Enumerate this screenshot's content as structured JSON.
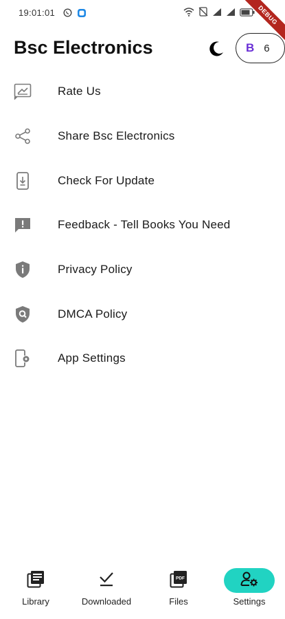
{
  "status_bar": {
    "time": "19:01:01",
    "debug_banner": "DEBUG",
    "icons": [
      "whatsapp-icon",
      "app-icon",
      "wifi-icon",
      "no-sim-icon",
      "signal-icon",
      "signal-icon",
      "battery-icon"
    ]
  },
  "header": {
    "title": "Bsc Electronics",
    "theme_icon": "moon-icon",
    "coin_symbol": "B",
    "coin_count": "6"
  },
  "menu": {
    "items": [
      {
        "label": "Rate Us",
        "icon": "rate-us-icon"
      },
      {
        "label": "Share Bsc Electronics",
        "icon": "share-icon"
      },
      {
        "label": "Check For Update",
        "icon": "phone-download-icon"
      },
      {
        "label": "Feedback - Tell Books You Need",
        "icon": "feedback-icon"
      },
      {
        "label": "Privacy Policy",
        "icon": "shield-info-icon"
      },
      {
        "label": "DMCA Policy",
        "icon": "shield-search-icon"
      },
      {
        "label": "App Settings",
        "icon": "phone-settings-icon"
      }
    ]
  },
  "bottom_nav": {
    "items": [
      {
        "label": "Library",
        "icon": "library-icon",
        "active": false
      },
      {
        "label": "Downloaded",
        "icon": "checkmark-icon",
        "active": false
      },
      {
        "label": "Files",
        "icon": "pdf-icon",
        "active": false
      },
      {
        "label": "Settings",
        "icon": "user-settings-icon",
        "active": true
      }
    ],
    "accent_color": "#21d3c2"
  },
  "colors": {
    "coin_symbol": "#6a2fd6",
    "icon_gray": "#7a7a7a",
    "debug_ribbon": "#b3261e"
  }
}
